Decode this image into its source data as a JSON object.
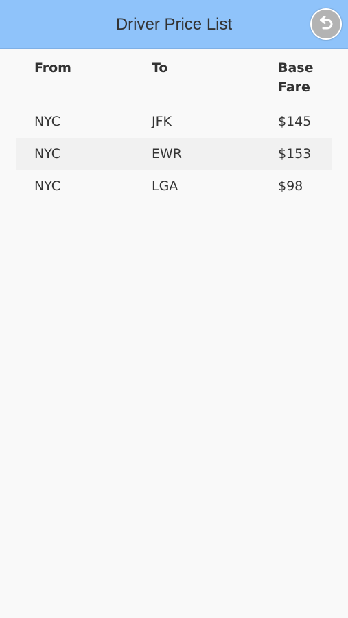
{
  "header": {
    "title": "Driver Price List",
    "back_icon": "undo-arrow-icon"
  },
  "table": {
    "columns": [
      "From",
      "To",
      "Base Fare"
    ],
    "rows": [
      {
        "from": "NYC",
        "to": "JFK",
        "fare": "$145"
      },
      {
        "from": "NYC",
        "to": "EWR",
        "fare": "$153"
      },
      {
        "from": "NYC",
        "to": "LGA",
        "fare": "$98"
      }
    ]
  },
  "colors": {
    "header_bg": "#8fc3fa",
    "page_bg": "#f9f9f9",
    "alt_row_bg": "#f1f1f1",
    "text": "#333333"
  }
}
